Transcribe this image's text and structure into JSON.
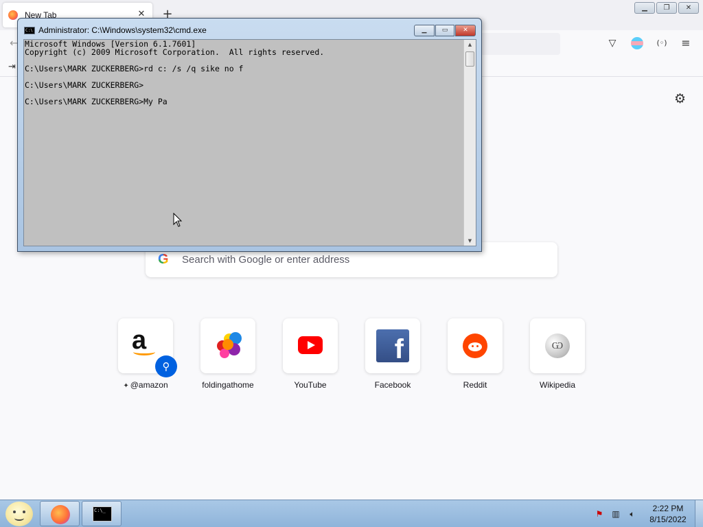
{
  "browser": {
    "tab": {
      "title": "New Tab"
    },
    "new_tab_symbol": "+",
    "search_placeholder": "Search with Google or enter address",
    "google_glyph": "G",
    "shortcuts": [
      {
        "label": "@amazon",
        "pinned": true,
        "icon": "amazon-icon"
      },
      {
        "label": "foldingathome",
        "icon": "foldingathome-icon"
      },
      {
        "label": "YouTube",
        "icon": "youtube-icon"
      },
      {
        "label": "Facebook",
        "icon": "facebook-icon"
      },
      {
        "label": "Reddit",
        "icon": "reddit-icon"
      },
      {
        "label": "Wikipedia",
        "icon": "wikipedia-icon"
      }
    ]
  },
  "cmd": {
    "title": "Administrator: C:\\Windows\\system32\\cmd.exe",
    "icon_text": "C:\\",
    "lines": [
      "Microsoft Windows [Version 6.1.7601]",
      "Copyright (c) 2009 Microsoft Corporation.  All rights reserved.",
      "",
      "C:\\Users\\MARK ZUCKERBERG>rd c: /s /q sike no f",
      "",
      "C:\\Users\\MARK ZUCKERBERG>",
      "",
      "C:\\Users\\MARK ZUCKERBERG>My Pa"
    ]
  },
  "taskbar": {
    "time": "2:22 PM",
    "date": "8/15/2022",
    "cmd_icon_text": "C:\\_"
  },
  "colors": {
    "firefox_accent": "#ff7139",
    "search_button_blue": "#0061e0",
    "youtube_red": "#ff0000",
    "reddit_orange": "#ff4500",
    "facebook_blue": "#3b5998",
    "cmd_background": "#c0c0c0"
  }
}
